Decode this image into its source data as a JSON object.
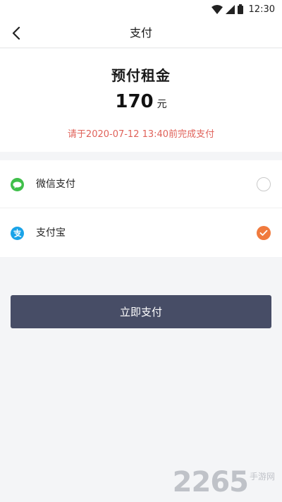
{
  "status_bar": {
    "time": "12:30",
    "icons": [
      "wifi-icon",
      "signal-icon",
      "battery-icon"
    ]
  },
  "nav": {
    "title": "支付",
    "back_icon": "chevron-left-icon"
  },
  "order": {
    "title": "预付租金",
    "amount": "170",
    "unit": "元",
    "deadline": "请于2020-07-12 13:40前完成支付"
  },
  "payment_methods": [
    {
      "label": "微信支付",
      "icon": "wechat-pay-icon",
      "selected": false
    },
    {
      "label": "支付宝",
      "icon": "alipay-icon",
      "selected": true
    }
  ],
  "pay_button": {
    "label": "立即支付"
  },
  "watermark": {
    "brand": "2265",
    "suffix": "手游网"
  },
  "colors": {
    "accent": "#f07a3d",
    "deadline": "#e0625a",
    "button": "#474d66",
    "wechat": "#3fbf4a",
    "alipay": "#1aa3e8",
    "background": "#f4f5f7"
  }
}
